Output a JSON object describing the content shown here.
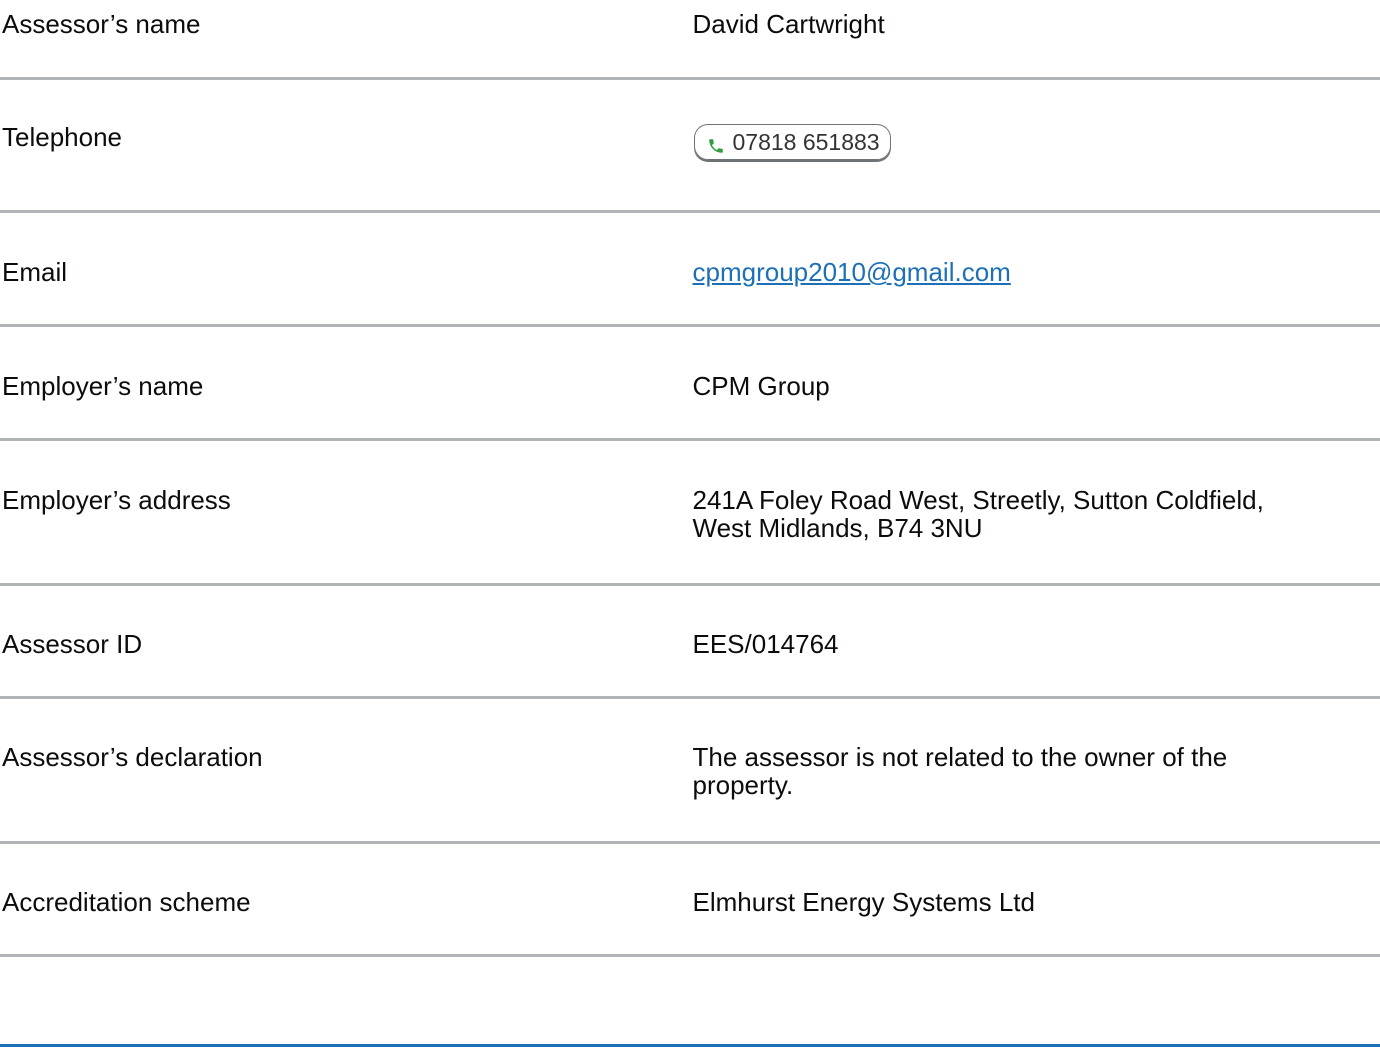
{
  "rows": [
    {
      "label": "Assessor’s name",
      "value": "David Cartwright"
    },
    {
      "label": "Telephone",
      "value": "07818 651883"
    },
    {
      "label": "Email",
      "value": "cpmgroup2010@gmail.com"
    },
    {
      "label": "Employer’s name",
      "value": "CPM Group"
    },
    {
      "label": "Employer’s address",
      "value_line1": "241A Foley Road West, Streetly, Sutton Coldfield,",
      "value_line2": "West Midlands, B74 3NU"
    },
    {
      "label": "Assessor ID",
      "value": "EES/014764"
    },
    {
      "label": "Assessor’s declaration",
      "value_line1": "The assessor is not related to the owner of the",
      "value_line2": "property."
    },
    {
      "label": "Accreditation scheme",
      "value": "Elmhurst Energy Systems Ltd"
    }
  ],
  "colors": {
    "link": "#1d70b8",
    "divider": "#b1b4b6",
    "phone_icon": "#2e9e3f",
    "bottom_rule": "#1d70b8"
  },
  "icons": {
    "phone": "phone-icon"
  }
}
